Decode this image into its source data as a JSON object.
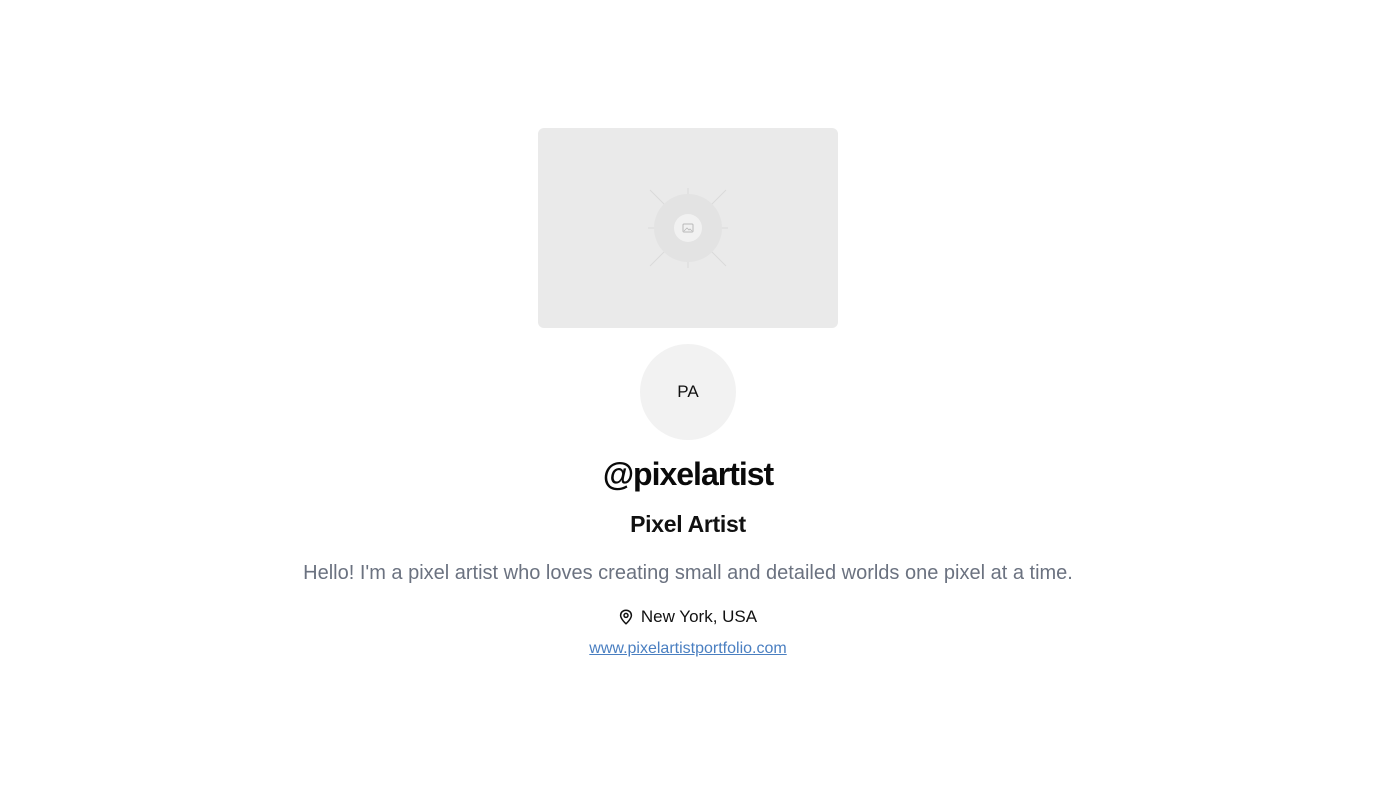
{
  "profile": {
    "cover_icon": "image-placeholder-icon",
    "avatar_initials": "PA",
    "username": "@pixelartist",
    "display_name": "Pixel Artist",
    "bio": "Hello! I'm a pixel artist who loves creating small and detailed worlds one pixel at a time.",
    "location_icon": "location-pin-icon",
    "location": "New York, USA",
    "website": "www.pixelartistportfolio.com"
  },
  "colors": {
    "background": "#ffffff",
    "cover_placeholder": "#eaeaea",
    "avatar_background": "#f2f2f2",
    "bio_text": "#6b7280",
    "link": "#4a7fc1"
  }
}
